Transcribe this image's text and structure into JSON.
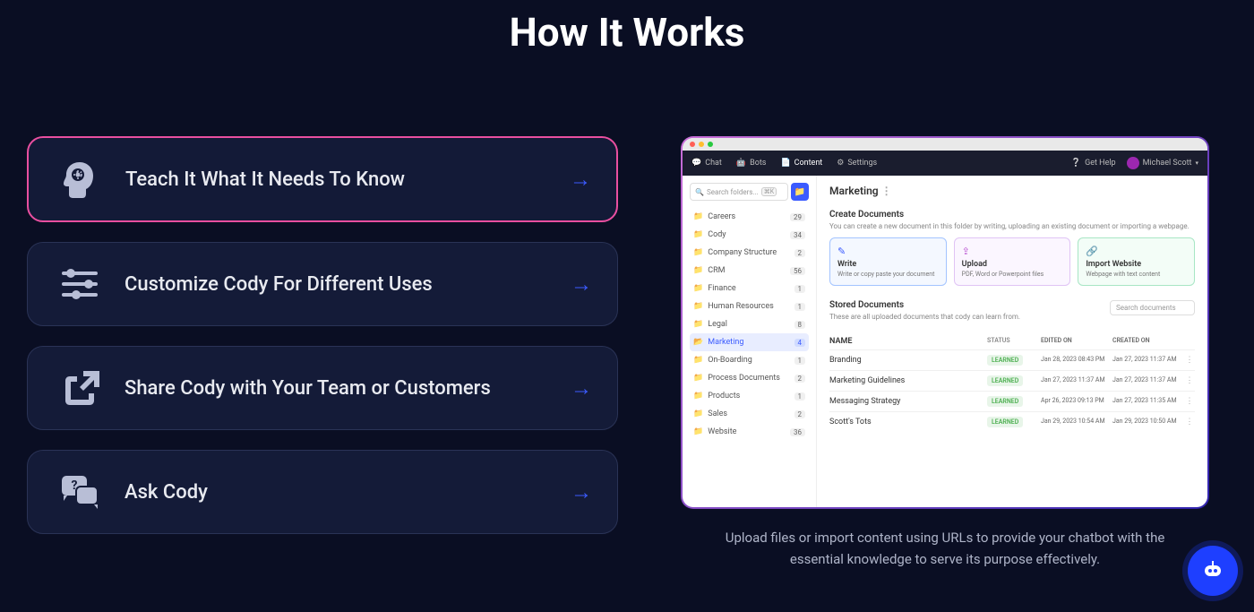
{
  "heading": "How It Works",
  "steps": [
    {
      "label": "Teach It What It Needs To Know",
      "active": true
    },
    {
      "label": "Customize Cody For Different Uses",
      "active": false
    },
    {
      "label": "Share Cody with Your Team or Customers",
      "active": false
    },
    {
      "label": "Ask Cody",
      "active": false
    }
  ],
  "caption": "Upload files or import content using URLs to provide your chatbot with the essential knowledge to serve its purpose effectively.",
  "app": {
    "tabs": {
      "chat": "Chat",
      "bots": "Bots",
      "content": "Content",
      "settings": "Settings"
    },
    "help": "Get Help",
    "user": "Michael Scott",
    "search_placeholder": "Search folders...",
    "search_kbd": "⌘K",
    "folders": [
      {
        "name": "Careers",
        "count": "29"
      },
      {
        "name": "Cody",
        "count": "34"
      },
      {
        "name": "Company Structure",
        "count": "2"
      },
      {
        "name": "CRM",
        "count": "56"
      },
      {
        "name": "Finance",
        "count": "1"
      },
      {
        "name": "Human Resources",
        "count": "1"
      },
      {
        "name": "Legal",
        "count": "8"
      },
      {
        "name": "Marketing",
        "count": "4",
        "selected": true
      },
      {
        "name": "On-Boarding",
        "count": "1"
      },
      {
        "name": "Process Documents",
        "count": "2"
      },
      {
        "name": "Products",
        "count": "1"
      },
      {
        "name": "Sales",
        "count": "2"
      },
      {
        "name": "Website",
        "count": "36"
      }
    ],
    "panel_title": "Marketing",
    "create": {
      "heading": "Create Documents",
      "sub": "You can create a new document in this folder by writing, uploading an existing document or importing a webpage.",
      "write_t": "Write",
      "write_d": "Write or copy paste your document",
      "upload_t": "Upload",
      "upload_d": "PDF, Word or Powerpoint files",
      "import_t": "Import Website",
      "import_d": "Webpage with text content"
    },
    "stored": {
      "heading": "Stored Documents",
      "sub": "These are all uploaded documents that cody can learn from.",
      "search": "Search documents",
      "cols": {
        "name": "NAME",
        "status": "STATUS",
        "edited": "EDITED ON",
        "created": "CREATED ON"
      },
      "badge": "LEARNED",
      "rows": [
        {
          "name": "Branding",
          "edited": "Jan 28, 2023 08:43 PM",
          "created": "Jan 27, 2023 11:37 AM"
        },
        {
          "name": "Marketing Guidelines",
          "edited": "Jan 27, 2023 11:37 AM",
          "created": "Jan 27, 2023 11:37 AM"
        },
        {
          "name": "Messaging Strategy",
          "edited": "Apr 26, 2023 09:13 PM",
          "created": "Jan 27, 2023 11:35 AM"
        },
        {
          "name": "Scott's Tots",
          "edited": "Jan 29, 2023 10:54 AM",
          "created": "Jan 29, 2023 10:50 AM"
        }
      ]
    }
  }
}
